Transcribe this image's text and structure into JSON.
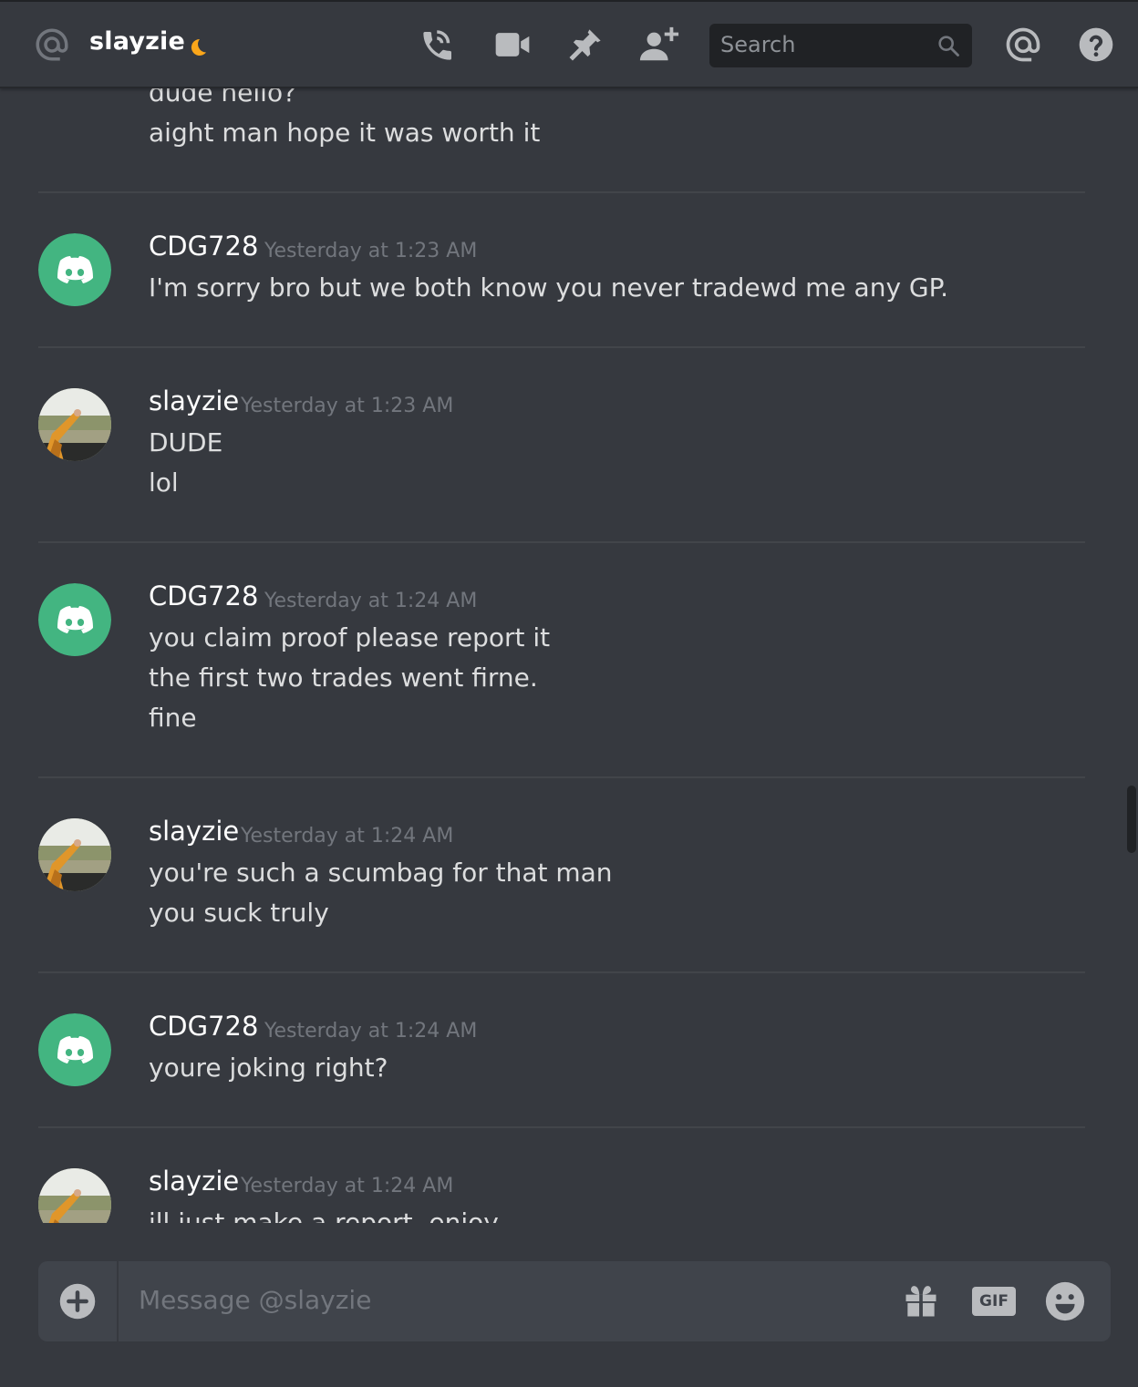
{
  "header": {
    "title": "slayzie",
    "search_placeholder": "Search"
  },
  "messages": {
    "partial_top_lines": [
      "dude hello?",
      "aight man hope it was worth it"
    ],
    "groups": [
      {
        "author": "CDG728",
        "timestamp": "Yesterday at 1:23 AM",
        "avatar": "discord-default-avatar",
        "lines": [
          "I'm sorry bro but we both know you never tradewd me any GP."
        ]
      },
      {
        "author": "slayzie",
        "timestamp": "Yesterday at 1:23 AM",
        "avatar": "slayzie-photo-avatar",
        "lines": [
          "DUDE",
          "lol"
        ]
      },
      {
        "author": "CDG728",
        "timestamp": "Yesterday at 1:24 AM",
        "avatar": "discord-default-avatar",
        "lines": [
          "you claim proof please report it",
          "the first two trades went firne.",
          "fine"
        ]
      },
      {
        "author": "slayzie",
        "timestamp": "Yesterday at 1:24 AM",
        "avatar": "slayzie-photo-avatar",
        "lines": [
          "you're such a scumbag for that man",
          "you suck truly"
        ]
      },
      {
        "author": "CDG728",
        "timestamp": "Yesterday at 1:24 AM",
        "avatar": "discord-default-avatar",
        "lines": [
          "youre joking right?"
        ]
      },
      {
        "author": "slayzie",
        "timestamp": "Yesterday at 1:24 AM",
        "avatar": "slayzie-photo-avatar",
        "lines": [
          "ill just make a report. enjoy"
        ]
      }
    ]
  },
  "composer": {
    "placeholder": "Message @slayzie",
    "gif_label": "GIF"
  },
  "colors": {
    "background": "#36393f",
    "discord_green": "#43b581",
    "idle_status": "#faa61a",
    "input_bg": "#40444b"
  }
}
